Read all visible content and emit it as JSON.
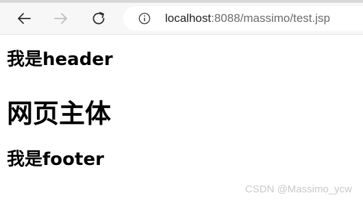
{
  "browser": {
    "url_host": "localhost",
    "url_rest": ":8088/massimo/test.jsp",
    "icons": {
      "back": "back-arrow-icon",
      "forward": "forward-arrow-icon",
      "reload": "reload-icon",
      "info": "info-icon"
    }
  },
  "page": {
    "header_text": "我是header",
    "main_text": "网页主体",
    "footer_text": "我是footer"
  },
  "watermark": "CSDN @Massimo_ycw"
}
